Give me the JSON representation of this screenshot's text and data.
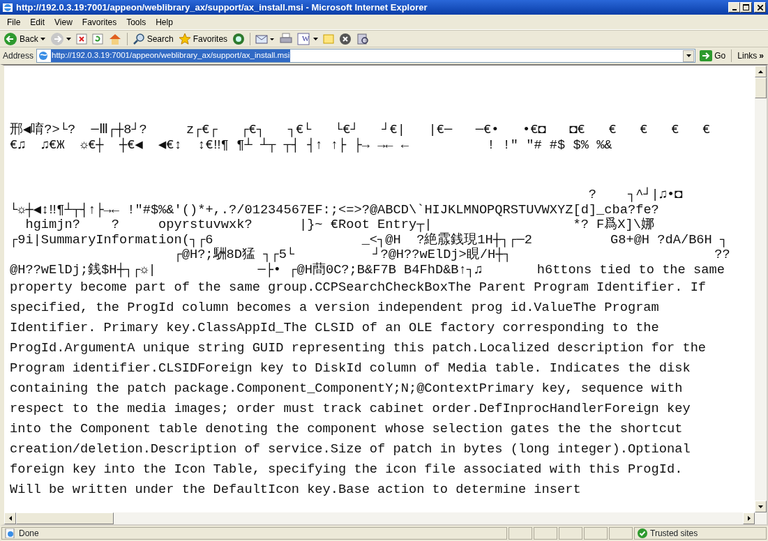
{
  "window": {
    "title": "http://192.0.3.19:7001/appeon/weblibrary_ax/support/ax_install.msi - Microsoft Internet Explorer"
  },
  "menu": [
    "File",
    "Edit",
    "View",
    "Favorites",
    "Tools",
    "Help"
  ],
  "toolbar": [
    {
      "kind": "back",
      "label": "Back"
    },
    {
      "kind": "forward"
    },
    {
      "kind": "stop"
    },
    {
      "kind": "refresh"
    },
    {
      "kind": "home"
    },
    {
      "kind": "search",
      "label": "Search"
    },
    {
      "kind": "favorites",
      "label": "Favorites"
    },
    {
      "kind": "media"
    },
    {
      "kind": "mail"
    },
    {
      "kind": "print"
    },
    {
      "kind": "edit",
      "label": "W"
    },
    {
      "kind": "note"
    },
    {
      "kind": "messenger"
    },
    {
      "kind": "research"
    }
  ],
  "address_bar": {
    "label": "Address",
    "value": "http://192.0.3.19:7001/appeon/weblibrary_ax/support/ax_install.msi",
    "go": "Go",
    "links": "Links",
    "more": "»"
  },
  "document": {
    "lines": [
      {
        "kind": "binary",
        "text": "邢◀唷?>└?  ─Ⅲ┌┼8┘?     z┌€┌   ┌€┐   ┐€└   └€┘   ┘€|   |€─   ─€•   •€◘   ◘€   €   €   €   €"
      },
      {
        "kind": "binary",
        "text": "€♫  ♫€Ж  ☼€┼  ┼€◀  ◀€↕  ↕€‼¶ ¶┴ ┴┬ ┬┤ ┤↑ ↑├ ├→ →← ←          ! !\" \"# #$ $% %&"
      },
      {
        "kind": "binary",
        "text": "                                                                          ?    ┐^┘|♫•◘"
      },
      {
        "kind": "binary",
        "text": "└☼┼◀↕‼¶┴┬┤↑├→← !\"#$%&'()*+,.?/01234567EF:;<=>?@ABCD\\`HIJKLMNOPQRSTUVWXYZ[d]_cba?fe?"
      },
      {
        "kind": "binary",
        "text": "  hgimjn?    ?     opyrstuvwxk?      |}~ €Root Entry┬|                  *? F爲X]\\娜"
      },
      {
        "kind": "binary",
        "text": "┌9i|SummaryInformation(┐┌6                   _<┐@H  ?絶霡銭現1H┼┐┌─2          G8+@H ?dA/B6H ┐"
      },
      {
        "kind": "binary",
        "text": "                     ┌@H?;駲8D猛 ┐┌5└          ┘?@H??wElDj>睍/H┼┐                          ??"
      },
      {
        "kind": "binary",
        "text": "@H??wElDj;銭$H┼┐┌☼|             ─├• ┌@H蕳0C?;B&F7B B4FhD&B↑┐♫       h6ttons tied to the same"
      },
      "property become part of the same group.CCPSearchCheckBoxThe Parent Program Identifier. If",
      "specified, the ProgId column becomes a version independent prog id.ValueThe Program",
      "Identifier. Primary key.ClassAppId_The CLSID of an OLE factory corresponding to the",
      "ProgId.ArgumentA unique string GUID representing this patch.Localized description for the",
      "Program identifier.CLSIDForeign key to DiskId column of Media table. Indicates the disk",
      "containing the patch package.Component_ComponentY;N;@ContextPrimary key, sequence with",
      "respect to the media images; order must track cabinet order.DefInprocHandlerForeign key",
      "into the Component table denoting the component whose selection gates the the shortcut",
      "creation/deletion.Description of service.Size of patch in bytes (long integer).Optional",
      "foreign key into the Icon Table, specifying the icon file associated with this ProgId.",
      "Will be written under the DefaultIcon key.Base action to determine insert"
    ]
  },
  "status_bar": {
    "text": "Done",
    "zone": "Trusted sites"
  }
}
